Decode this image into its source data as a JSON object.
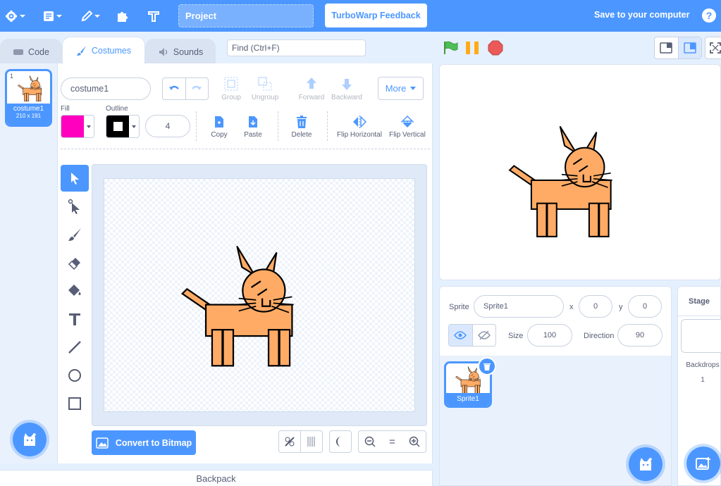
{
  "menubar": {
    "project_title": "Project",
    "feedback_label": "TurboWarp Feedback",
    "save_label": "Save to your computer",
    "help_label": "?"
  },
  "tabs": [
    {
      "label": "Code",
      "icon": "code-icon"
    },
    {
      "label": "Costumes",
      "icon": "brush-icon"
    },
    {
      "label": "Sounds",
      "icon": "speaker-icon"
    }
  ],
  "find": {
    "placeholder": "Find (Ctrl+F)"
  },
  "costume_list": {
    "items": [
      {
        "index": "1",
        "name": "costume1",
        "size": "210 x 191"
      }
    ]
  },
  "editor": {
    "costume_name": "costume1",
    "group_label": "Group",
    "ungroup_label": "Ungroup",
    "forward_label": "Forward",
    "backward_label": "Backward",
    "more_label": "More",
    "fill_label": "Fill",
    "outline_label": "Outline",
    "fill_color": "#ff00bf",
    "outline_color": "#000000",
    "outline_width": "4",
    "copy_label": "Copy",
    "paste_label": "Paste",
    "delete_label": "Delete",
    "flip_h_label": "Flip Horizontal",
    "flip_v_label": "Flip Vertical",
    "convert_label": "Convert to Bitmap",
    "zoom_reset": "="
  },
  "backpack": {
    "label": "Backpack"
  },
  "sprite_info": {
    "sprite_label": "Sprite",
    "sprite_name": "Sprite1",
    "x_label": "x",
    "x_value": "0",
    "y_label": "y",
    "y_value": "0",
    "size_label": "Size",
    "size_value": "100",
    "direction_label": "Direction",
    "direction_value": "90"
  },
  "sprites": [
    {
      "name": "Sprite1"
    }
  ],
  "stage_panel": {
    "title": "Stage",
    "backdrops_label": "Backdrops",
    "backdrops_count": "1"
  },
  "colors": {
    "accent": "#4c97ff",
    "cat": "#ffab66"
  }
}
